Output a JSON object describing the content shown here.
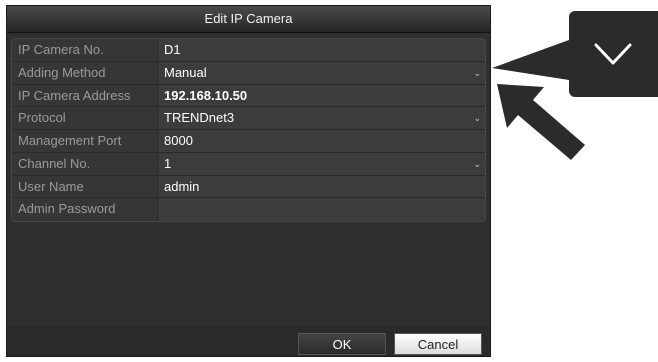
{
  "dialog": {
    "title": "Edit IP Camera",
    "fields": [
      {
        "label": "IP Camera No.",
        "value": "D1",
        "has_dropdown": false,
        "bold": false
      },
      {
        "label": "Adding Method",
        "value": "Manual",
        "has_dropdown": true,
        "bold": false
      },
      {
        "label": "IP Camera Address",
        "value": "192.168.10.50",
        "has_dropdown": false,
        "bold": true
      },
      {
        "label": "Protocol",
        "value": "TRENDnet3",
        "has_dropdown": true,
        "bold": false
      },
      {
        "label": "Management Port",
        "value": "8000",
        "has_dropdown": false,
        "bold": false
      },
      {
        "label": "Channel No.",
        "value": "1",
        "has_dropdown": true,
        "bold": false
      },
      {
        "label": "User Name",
        "value": "admin",
        "has_dropdown": false,
        "bold": false
      },
      {
        "label": "Admin Password",
        "value": "",
        "has_dropdown": false,
        "bold": false
      }
    ],
    "ok_label": "OK",
    "cancel_label": "Cancel"
  },
  "callout": {
    "icon": "chevron-down-icon",
    "arrow_icon": "pointer-arrow-icon"
  },
  "colors": {
    "dialog_bg": "#2f2f2f",
    "label_text": "#9a9a9a",
    "value_text": "#ffffff",
    "callout_bg": "#2b2b2b"
  }
}
